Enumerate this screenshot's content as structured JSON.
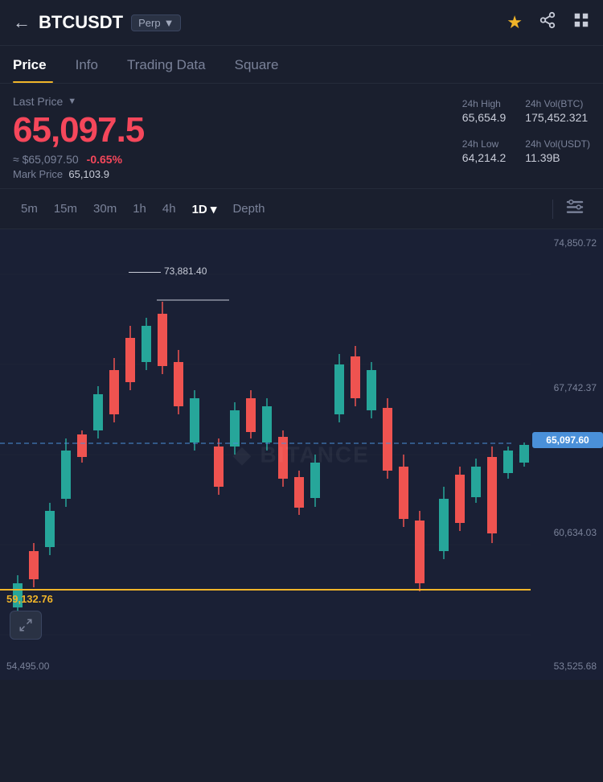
{
  "header": {
    "back_label": "←",
    "pair": "BTCUSDT",
    "type": "Perp",
    "dropdown_arrow": "▼"
  },
  "tabs": [
    {
      "label": "Price",
      "active": true
    },
    {
      "label": "Info",
      "active": false
    },
    {
      "label": "Trading Data",
      "active": false
    },
    {
      "label": "Square",
      "active": false
    }
  ],
  "price": {
    "last_price_label": "Last Price",
    "main": "65,097.5",
    "usd": "≈ $65,097.50",
    "change": "-0.65%",
    "mark_label": "Mark Price",
    "mark_value": "65,103.9"
  },
  "stats": {
    "high_label": "24h High",
    "high_value": "65,654.9",
    "vol_btc_label": "24h Vol(BTC)",
    "vol_btc_value": "175,452.321",
    "low_label": "24h Low",
    "low_value": "64,214.2",
    "vol_usdt_label": "24h Vol(USDT)",
    "vol_usdt_value": "11.39B"
  },
  "toolbar": {
    "times": [
      "5m",
      "15m",
      "30m",
      "1h",
      "4h",
      "1D",
      "Depth"
    ],
    "active_time": "1D",
    "settings_icon": "⊟"
  },
  "chart": {
    "price_levels": [
      "74,850.72",
      "67,742.37",
      "60,634.03"
    ],
    "current_price_tag": "65,097.60",
    "max_label": "73,881.40",
    "support_label": "59,132.76",
    "watermark": "◆ BITANC",
    "bottom_left": "54,495.00",
    "bottom_right": "53,525.68"
  }
}
